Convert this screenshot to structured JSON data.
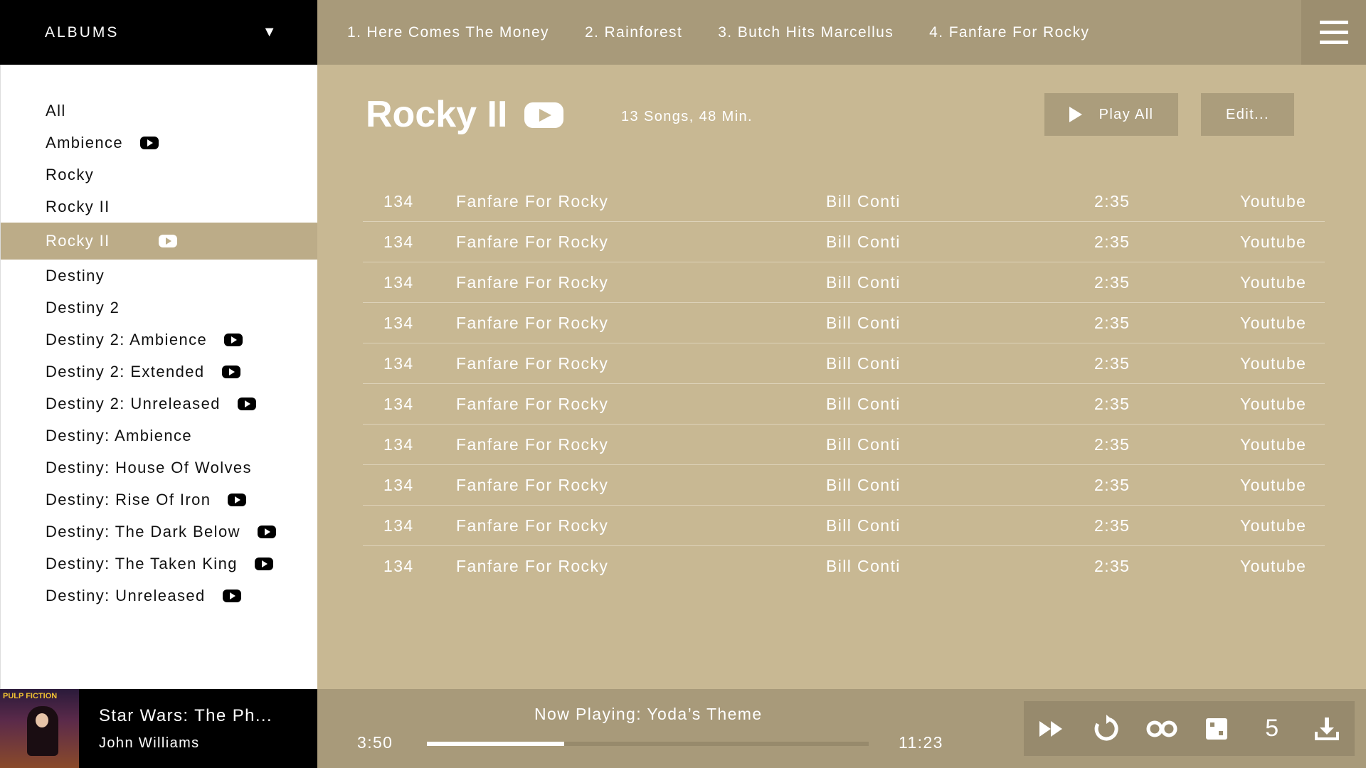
{
  "sidebar": {
    "header": "ALBUMS",
    "albums": [
      {
        "label": "All",
        "youtube": false,
        "active": false
      },
      {
        "label": "Ambience",
        "youtube": true,
        "active": false
      },
      {
        "label": "Rocky",
        "youtube": false,
        "active": false
      },
      {
        "label": "Rocky II",
        "youtube": false,
        "active": false
      },
      {
        "label": "Rocky II",
        "youtube": true,
        "active": true
      },
      {
        "label": "Destiny",
        "youtube": false,
        "active": false
      },
      {
        "label": "Destiny 2",
        "youtube": false,
        "active": false
      },
      {
        "label": "Destiny 2: Ambience",
        "youtube": true,
        "active": false
      },
      {
        "label": "Destiny 2: Extended",
        "youtube": true,
        "active": false
      },
      {
        "label": "Destiny 2: Unreleased",
        "youtube": true,
        "active": false
      },
      {
        "label": "Destiny: Ambience",
        "youtube": false,
        "active": false
      },
      {
        "label": "Destiny: House Of Wolves",
        "youtube": false,
        "active": false
      },
      {
        "label": "Destiny: Rise Of Iron",
        "youtube": true,
        "active": false
      },
      {
        "label": "Destiny: The Dark Below",
        "youtube": true,
        "active": false
      },
      {
        "label": "Destiny: The Taken King",
        "youtube": true,
        "active": false
      },
      {
        "label": "Destiny: Unreleased",
        "youtube": true,
        "active": false
      }
    ]
  },
  "tabs": [
    "1. Here Comes The Money",
    "2. Rainforest",
    "3. Butch Hits Marcellus",
    "4. Fanfare For Rocky"
  ],
  "album": {
    "title": "Rocky II",
    "meta": "13 Songs, 48 Min.",
    "play_all_label": "Play All",
    "edit_label": "Edit..."
  },
  "tracks": [
    {
      "num": "134",
      "title": "Fanfare For Rocky",
      "artist": "Bill Conti",
      "duration": "2:35",
      "source": "Youtube"
    },
    {
      "num": "134",
      "title": "Fanfare For Rocky",
      "artist": "Bill Conti",
      "duration": "2:35",
      "source": "Youtube"
    },
    {
      "num": "134",
      "title": "Fanfare For Rocky",
      "artist": "Bill Conti",
      "duration": "2:35",
      "source": "Youtube"
    },
    {
      "num": "134",
      "title": "Fanfare For Rocky",
      "artist": "Bill Conti",
      "duration": "2:35",
      "source": "Youtube"
    },
    {
      "num": "134",
      "title": "Fanfare For Rocky",
      "artist": "Bill Conti",
      "duration": "2:35",
      "source": "Youtube"
    },
    {
      "num": "134",
      "title": "Fanfare For Rocky",
      "artist": "Bill Conti",
      "duration": "2:35",
      "source": "Youtube"
    },
    {
      "num": "134",
      "title": "Fanfare For Rocky",
      "artist": "Bill Conti",
      "duration": "2:35",
      "source": "Youtube"
    },
    {
      "num": "134",
      "title": "Fanfare For Rocky",
      "artist": "Bill Conti",
      "duration": "2:35",
      "source": "Youtube"
    },
    {
      "num": "134",
      "title": "Fanfare For Rocky",
      "artist": "Bill Conti",
      "duration": "2:35",
      "source": "Youtube"
    },
    {
      "num": "134",
      "title": "Fanfare For Rocky",
      "artist": "Bill Conti",
      "duration": "2:35",
      "source": "Youtube"
    }
  ],
  "player": {
    "track_title": "Star Wars: The Ph...",
    "artist": "John Williams",
    "album_art_text": "PULP FICTION",
    "now_playing": "Now Playing: Yoda’s Theme",
    "elapsed": "3:50",
    "total": "11:23",
    "progress_fraction": 0.31,
    "queue_count": "5",
    "icons": [
      "fast-forward-icon",
      "repeat-icon",
      "loop-infinity-icon",
      "shuffle-dice-icon",
      "download-icon"
    ]
  },
  "colors": {
    "background": "#c8b893",
    "bar": "#a89a7a",
    "sidebar_active": "#bcac88",
    "dark": "#000000"
  }
}
